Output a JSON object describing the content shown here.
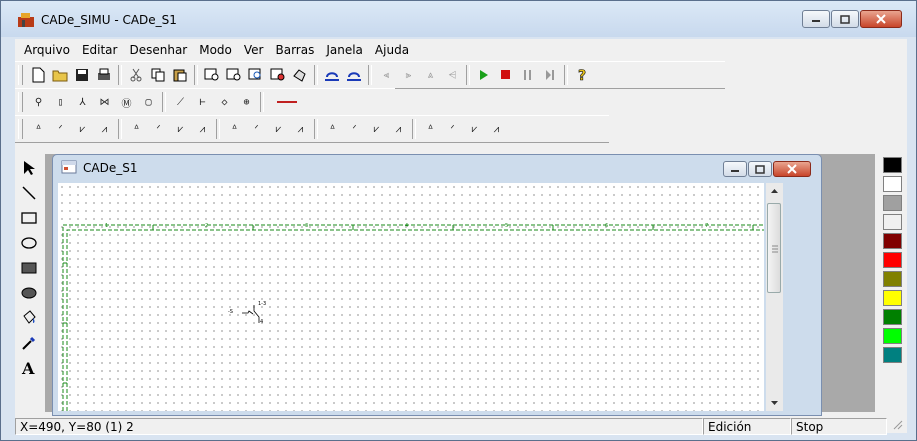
{
  "window": {
    "title": "CADe_SIMU - CADe_S1"
  },
  "menu": [
    "Arquivo",
    "Editar",
    "Desenhar",
    "Modo",
    "Ver",
    "Barras",
    "Janela",
    "Ajuda"
  ],
  "child": {
    "title": "CADe_S1"
  },
  "canvas": {
    "ruler_numbers": [
      "1",
      "2",
      "3",
      "4",
      "5",
      "6",
      "7"
    ],
    "component_labels": {
      "left": "-S",
      "top": "1-3",
      "bottom": "4"
    }
  },
  "colors": [
    "#000000",
    "#ffffff",
    "#a0a0a0",
    "#f0f0f0",
    "#800000",
    "#ff0000",
    "#808000",
    "#ffff00",
    "#008000",
    "#00ff00",
    "#008080"
  ],
  "status": {
    "coords": "X=490, Y=80 (1) 2",
    "mode": "Edición",
    "state": "Stop"
  }
}
